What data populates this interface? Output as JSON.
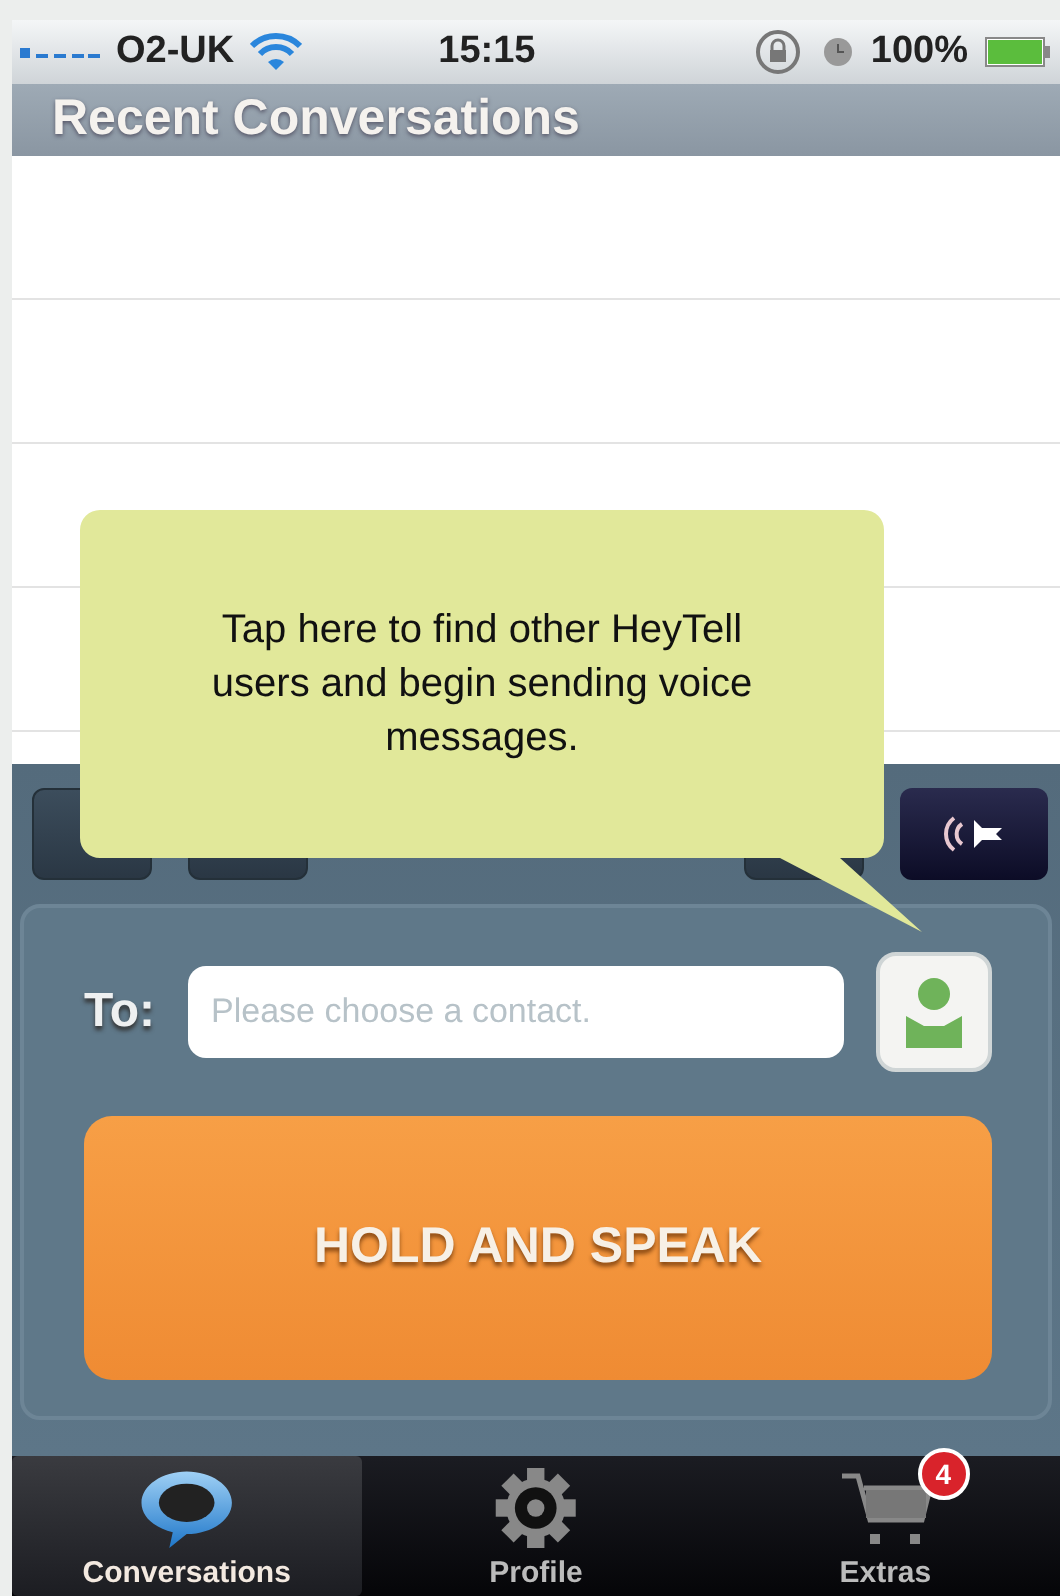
{
  "status_bar": {
    "carrier": "O2-UK",
    "time": "15:15",
    "battery": "100%"
  },
  "header": {
    "title": "Recent Conversations"
  },
  "tooltip": {
    "text": "Tap here to find other HeyTell users and begin sending voice messages."
  },
  "recipient": {
    "label": "To:",
    "placeholder": "Please choose a contact."
  },
  "talk_button": {
    "label": "HOLD AND SPEAK"
  },
  "tabs": [
    {
      "label": "Conversations",
      "kind": "chat",
      "selected": true
    },
    {
      "label": "Profile",
      "kind": "gear",
      "selected": false
    },
    {
      "label": "Extras",
      "kind": "cart",
      "selected": false,
      "badge": "4"
    }
  ]
}
